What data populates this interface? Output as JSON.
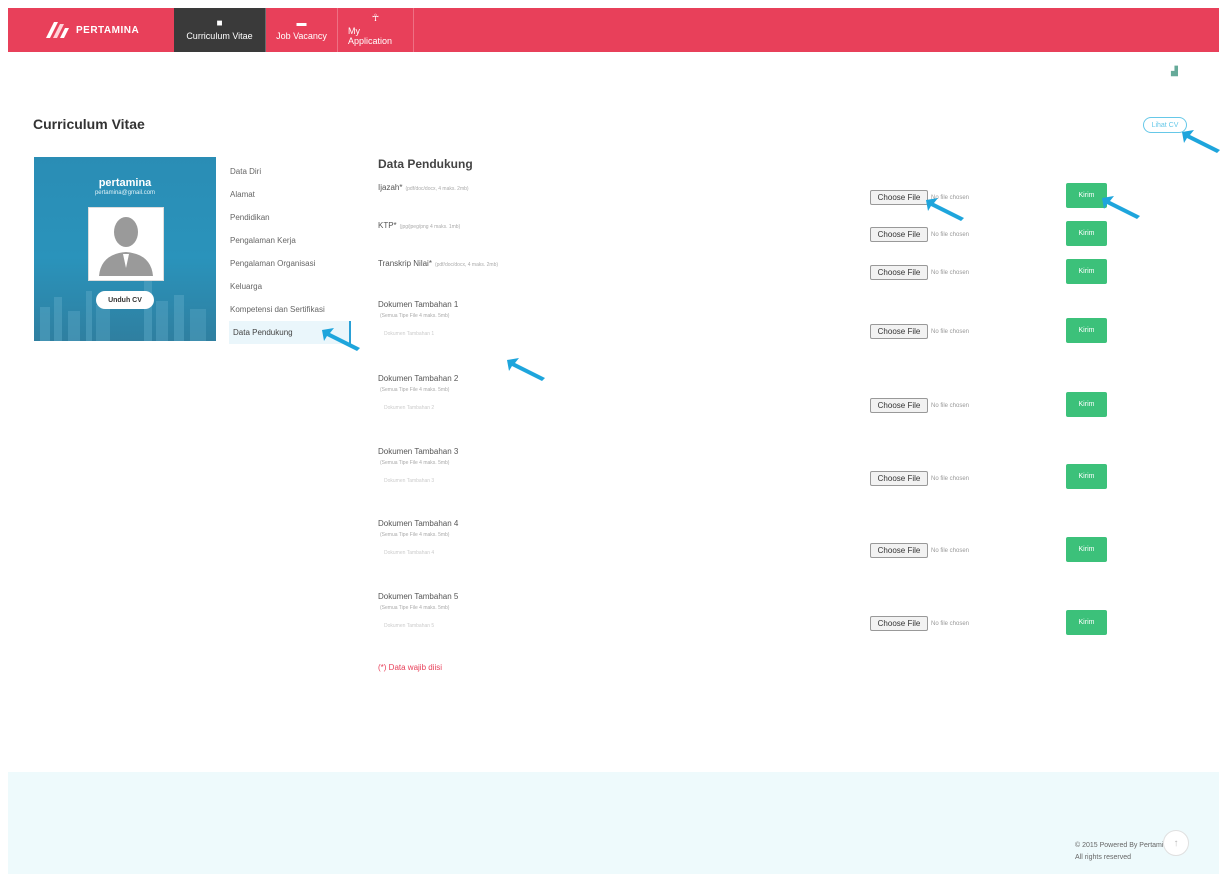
{
  "nav": {
    "brand": "PERTAMINA",
    "tabs": [
      {
        "label": "Curriculum Vitae",
        "icon": "briefcase-icon"
      },
      {
        "label": "Job Vacancy",
        "icon": "bag-icon"
      },
      {
        "label": "My Application",
        "icon": "person-icon"
      }
    ]
  },
  "page": {
    "title": "Curriculum Vitae",
    "lihat_cv": "Lihat CV"
  },
  "profile": {
    "name": "pertamina",
    "email": "pertamina@gmail.com",
    "download_label": "Unduh CV"
  },
  "side_menu": [
    "Data Diri",
    "Alamat",
    "Pendidikan",
    "Pengalaman Kerja",
    "Pengalaman Organisasi",
    "Keluarga",
    "Kompetensi dan Sertifikasi",
    "Data Pendukung"
  ],
  "section": {
    "title": "Data Pendukung",
    "choose_label": "Choose File",
    "no_file": "No file chosen",
    "send_label": "Kirim",
    "required_note": "(*) Data wajib diisi",
    "docs": [
      {
        "label": "Ijazah*",
        "hint": "(pdf/doc/docx, 4 maks. 2mb)"
      },
      {
        "label": "KTP*",
        "hint": "(jpg/jpeg/png 4 maks. 1mb)"
      },
      {
        "label": "Transkrip Nilai*",
        "hint": "(pdf/doc/docx, 4 maks. 2mb)"
      },
      {
        "label": "Dokumen Tambahan 1",
        "sub": "(Semua Tipe File 4 maks. 5mb)",
        "placeholder": "Dokumen Tambahan 1"
      },
      {
        "label": "Dokumen Tambahan 2",
        "sub": "(Semua Tipe File 4 maks. 5mb)",
        "placeholder": "Dokumen Tambahan 2"
      },
      {
        "label": "Dokumen Tambahan 3",
        "sub": "(Semua Tipe File 4 maks. 5mb)",
        "placeholder": "Dokumen Tambahan 3"
      },
      {
        "label": "Dokumen Tambahan 4",
        "sub": "(Semua Tipe File 4 maks. 5mb)",
        "placeholder": "Dokumen Tambahan 4"
      },
      {
        "label": "Dokumen Tambahan 5",
        "sub": "(Semua Tipe File 4 maks. 5mb)",
        "placeholder": "Dokumen Tambahan 5"
      }
    ]
  },
  "footer": {
    "copyright": "© 2015 Powered By Pertamina",
    "rights": "All rights reserved",
    "scroll_top": "↑"
  },
  "colors": {
    "navbar": "#e8405a",
    "active_tab": "#3a3a3a",
    "kirim": "#3cc17a",
    "arrow": "#1ea5dc",
    "required": "#e8405a"
  }
}
